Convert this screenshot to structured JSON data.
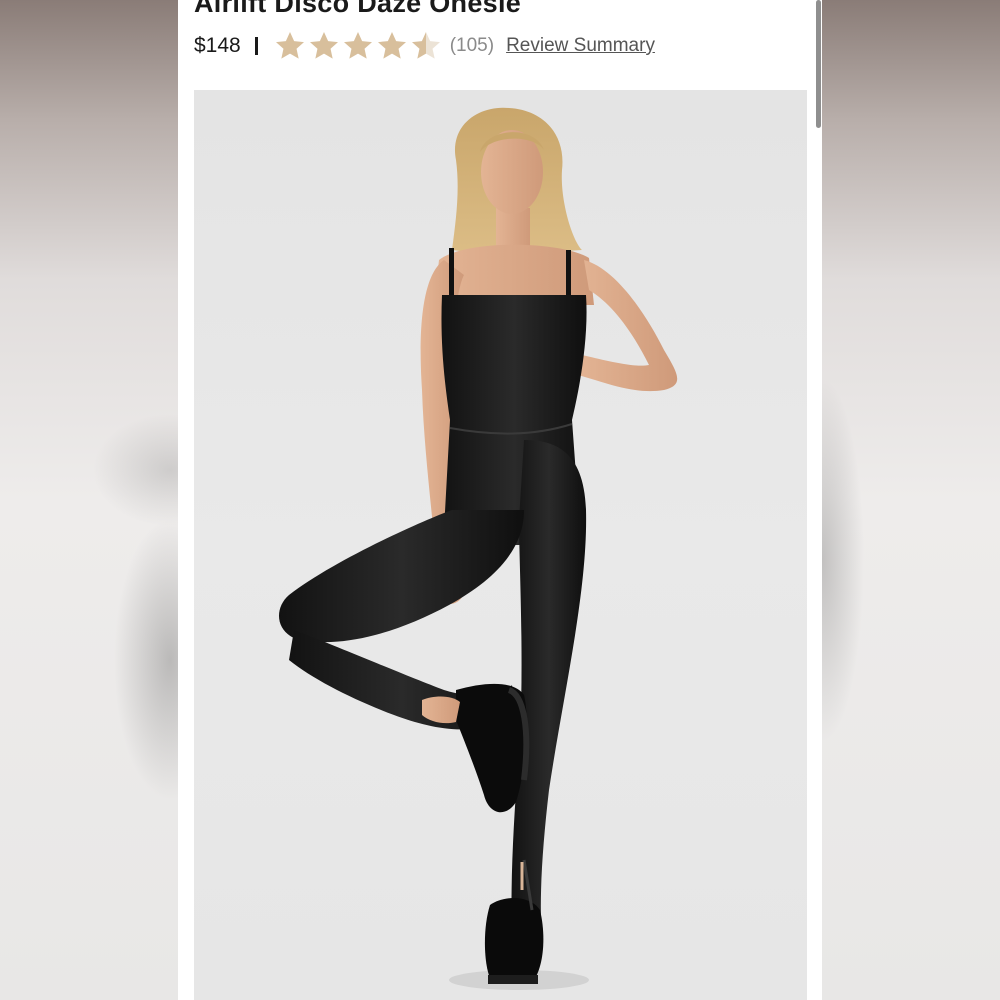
{
  "product": {
    "title": "Airlift Disco Daze Onesie",
    "price": "$148",
    "rating_value": 4.5,
    "rating_max": 5,
    "review_count": "(105)",
    "review_link_label": "Review Summary",
    "image_alt": "Model wearing black onesie"
  },
  "icons": {
    "star": "star-icon",
    "half_star": "half-star-icon"
  },
  "colors": {
    "star_fill": "#d8bf9c",
    "star_empty": "#ece3d6",
    "text": "#1a1a1a",
    "muted": "#8a8a8a"
  }
}
